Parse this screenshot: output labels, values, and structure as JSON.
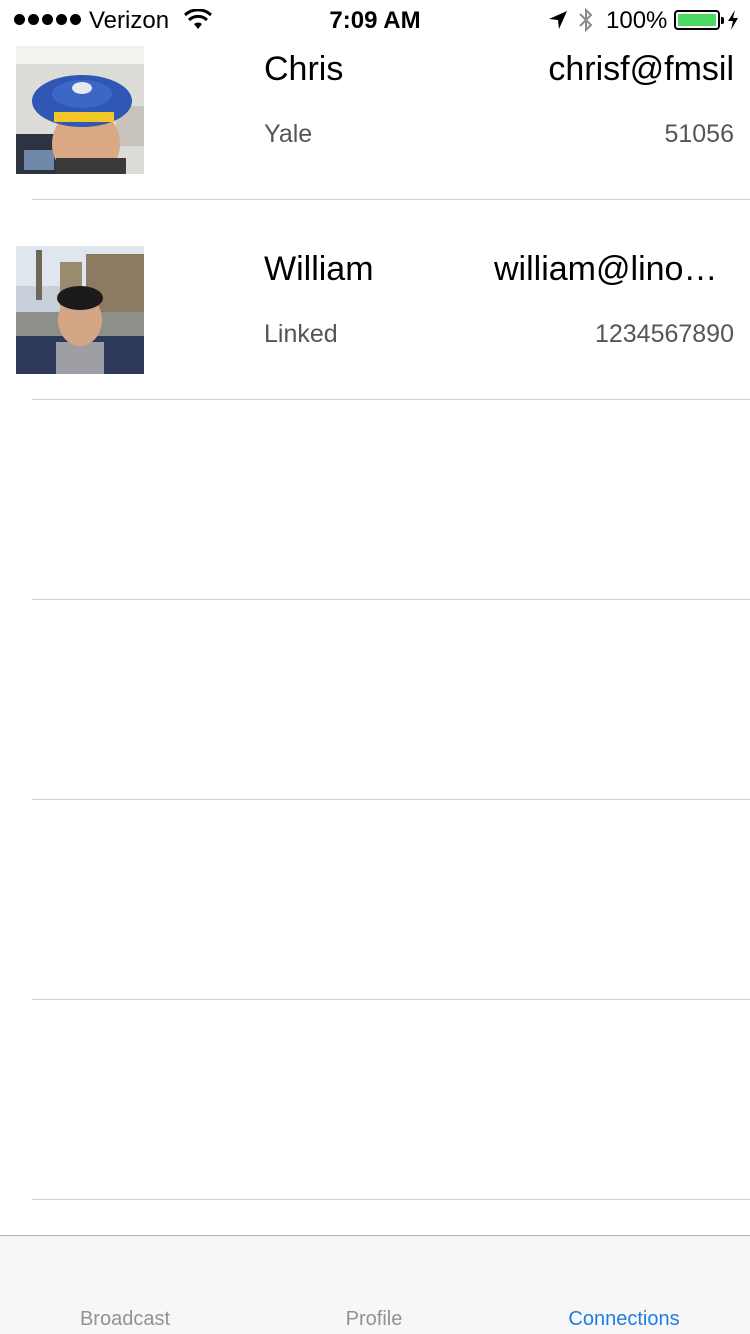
{
  "status_bar": {
    "carrier": "Verizon",
    "time": "7:09 AM",
    "battery_percent": "100%",
    "battery_color": "#4cd964"
  },
  "connections": [
    {
      "name": "Chris",
      "email": "chrisf@fmsil",
      "organization": "Yale",
      "phone": "51056"
    },
    {
      "name": "William",
      "email": "william@linoandosmith.com",
      "organization": "Linked",
      "phone": "1234567890"
    }
  ],
  "tab_bar": {
    "tabs": [
      {
        "label": "Broadcast",
        "active": false
      },
      {
        "label": "Profile",
        "active": false
      },
      {
        "label": "Connections",
        "active": true
      }
    ],
    "active_color": "#1e7fe0"
  }
}
